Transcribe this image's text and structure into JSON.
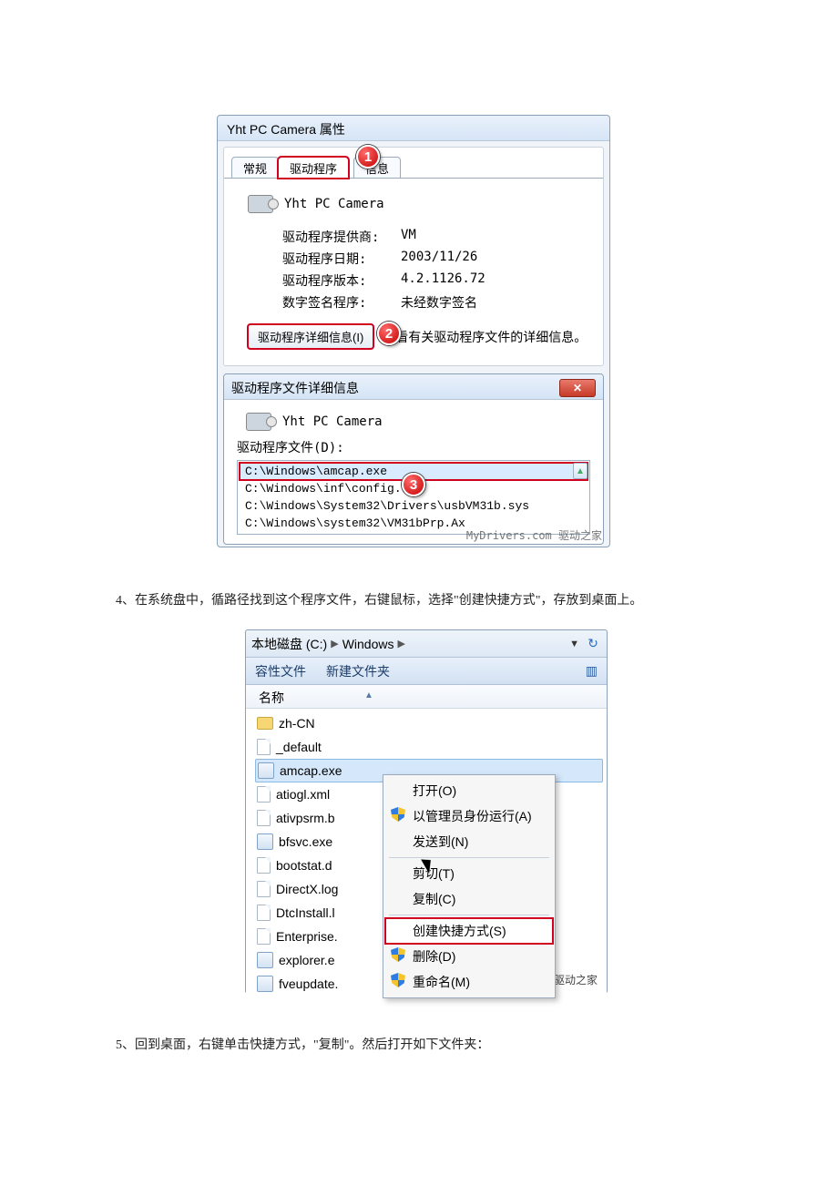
{
  "article": {
    "step4": "4、在系统盘中，循路径找到这个程序文件，右键鼠标，选择\"创建快捷方式\"，存放到桌面上。",
    "step5": "5、回到桌面，右键单击快捷方式，\"复制\"。然后打开如下文件夹："
  },
  "shot1": {
    "window_title": "Yht PC Camera 属性",
    "tabs": {
      "general": "常规",
      "driver": "驱动程序",
      "details": "信息"
    },
    "callouts": {
      "c1": "1",
      "c2": "2",
      "c3": "3"
    },
    "device_name": "Yht PC Camera",
    "fields": {
      "provider_label": "驱动程序提供商:",
      "provider_value": "VM",
      "date_label": "驱动程序日期:",
      "date_value": "2003/11/26",
      "version_label": "驱动程序版本:",
      "version_value": "4.2.1126.72",
      "signer_label": "数字签名程序:",
      "signer_value": "未经数字签名"
    },
    "detail_button": "驱动程序详细信息(I)",
    "detail_desc": "查看有关驱动程序文件的详细信息。",
    "files_dialog": {
      "title": "驱动程序文件详细信息",
      "device_name": "Yht PC Camera",
      "list_label": "驱动程序文件(D):",
      "files": [
        "C:\\Windows\\amcap.exe",
        "C:\\Windows\\inf\\config.set",
        "C:\\Windows\\System32\\Drivers\\usbVM31b.sys",
        "C:\\Windows\\system32\\VM31bPrp.Ax"
      ],
      "scroll_up": "▲"
    },
    "watermark": "MyDrivers.com 驱动之家"
  },
  "shot2": {
    "breadcrumb": {
      "p1": "本地磁盘 (C:)",
      "p2": "Windows"
    },
    "toolbar": {
      "b1": "容性文件",
      "b2": "新建文件夹"
    },
    "header": {
      "name": "名称"
    },
    "items": [
      {
        "name": "zh-CN",
        "type": "folder"
      },
      {
        "name": "_default",
        "type": "file"
      },
      {
        "name": "amcap.exe",
        "type": "exe",
        "selected": true
      },
      {
        "name": "atiogl.xml",
        "type": "file"
      },
      {
        "name": "ativpsrm.b",
        "type": "file"
      },
      {
        "name": "bfsvc.exe",
        "type": "exe"
      },
      {
        "name": "bootstat.d",
        "type": "file"
      },
      {
        "name": "DirectX.log",
        "type": "file"
      },
      {
        "name": "DtcInstall.l",
        "type": "file"
      },
      {
        "name": "Enterprise.",
        "type": "file"
      },
      {
        "name": "explorer.e",
        "type": "exe"
      },
      {
        "name": "fveupdate.",
        "type": "exe"
      }
    ],
    "context_menu": {
      "open": "打开(O)",
      "run_as_admin": "以管理员身份运行(A)",
      "send_to": "发送到(N)",
      "cut": "剪切(T)",
      "copy": "复制(C)",
      "create_shortcut": "创建快捷方式(S)",
      "delete": "删除(D)",
      "rename": "重命名(M)"
    },
    "watermark": "MyDrivers.com 驱动之家"
  }
}
